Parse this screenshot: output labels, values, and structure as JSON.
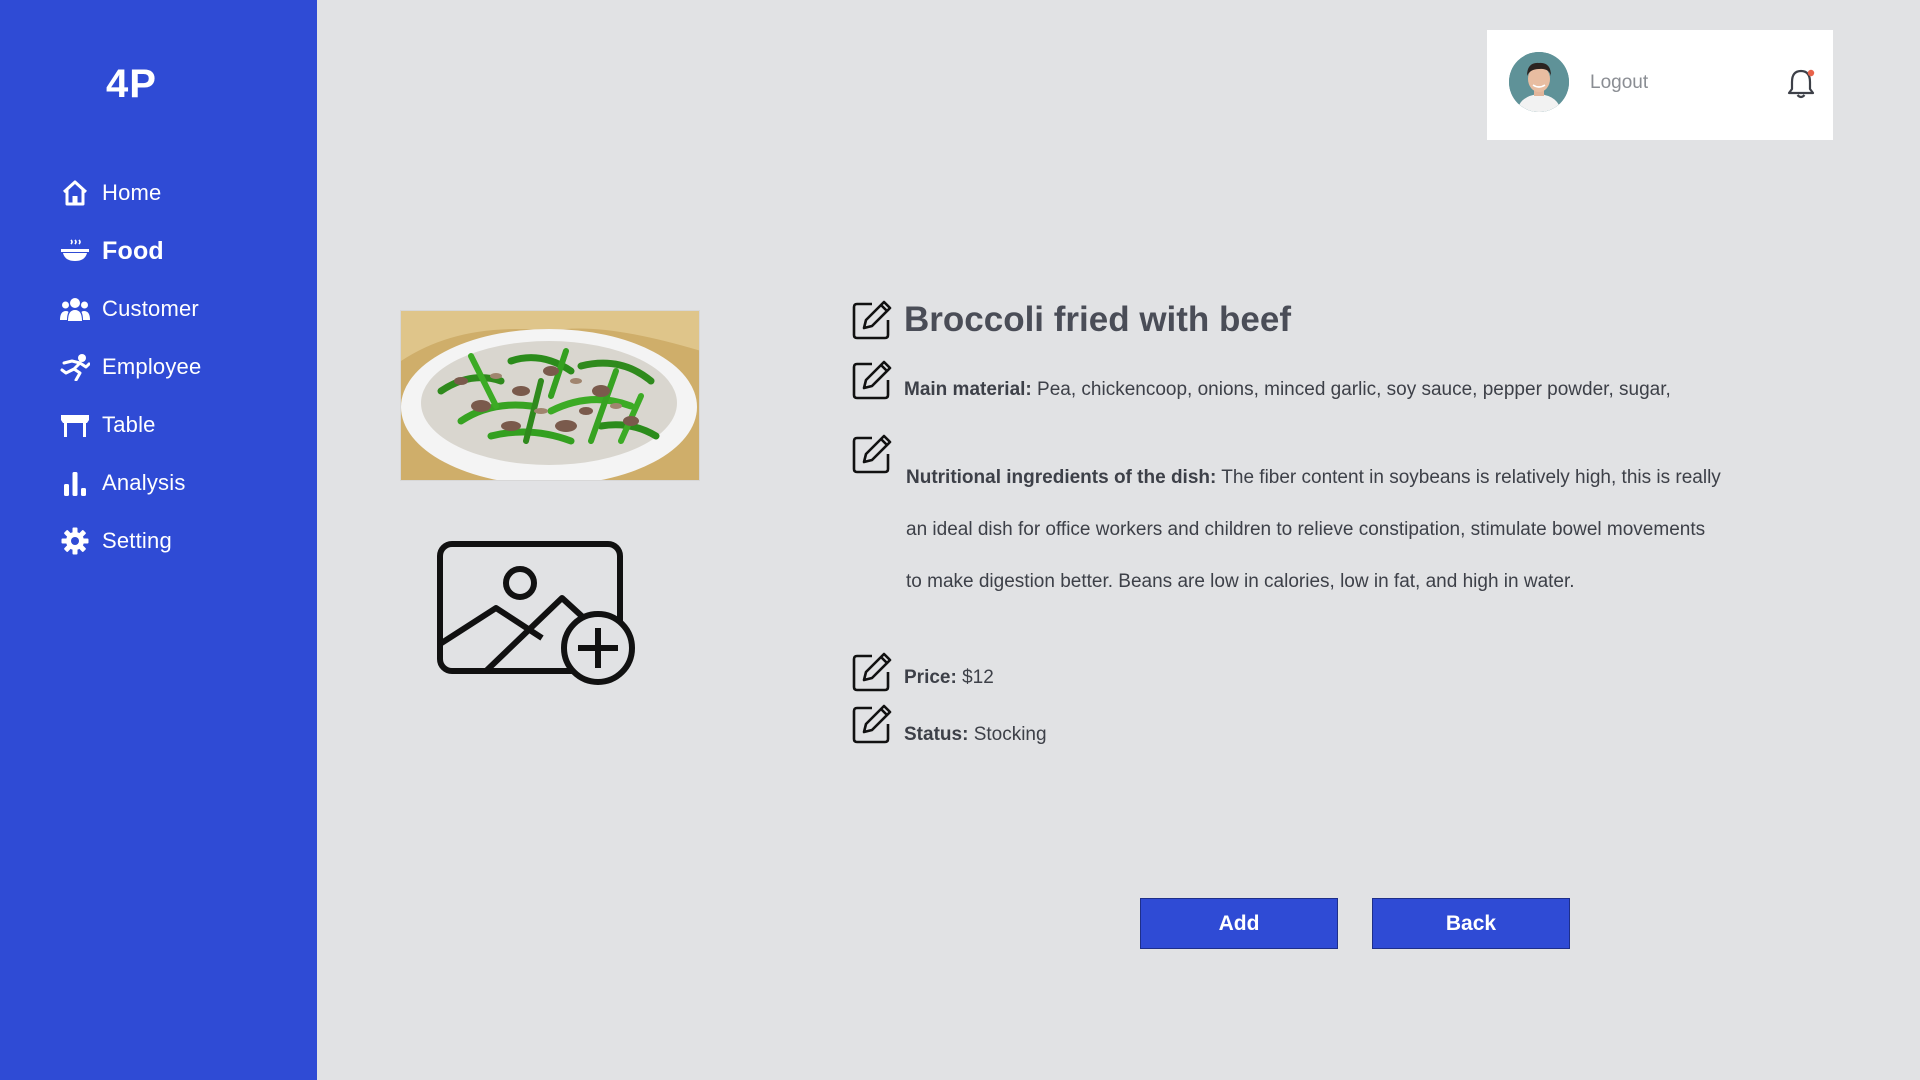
{
  "app": {
    "logo": "4P"
  },
  "sidebar": {
    "items": [
      {
        "label": "Home",
        "icon": "home-icon"
      },
      {
        "label": "Food",
        "icon": "food-bowl-icon",
        "active": true
      },
      {
        "label": "Customer",
        "icon": "users-icon"
      },
      {
        "label": "Employee",
        "icon": "employee-icon"
      },
      {
        "label": "Table",
        "icon": "table-icon"
      },
      {
        "label": "Analysis",
        "icon": "bar-chart-icon"
      },
      {
        "label": "Setting",
        "icon": "gear-icon"
      }
    ]
  },
  "header": {
    "logout_label": "Logout",
    "avatar_icon": "user-avatar",
    "bell_icon": "bell-icon"
  },
  "dish": {
    "title": "Broccoli fried with beef",
    "main_material_label": "Main material:",
    "main_material_value": "Pea, chickencoop, onions, minced garlic, soy sauce, pepper powder, sugar,",
    "nutrition_label": "Nutritional ingredients of the dish:",
    "nutrition_value": "The fiber  content in  soybeans is  relatively high,  this is really an ideal dish for office  workers and  children to relieve  constipation, stimulate bowel movements to make digestion better. Beans are low in calories, low in fat, and high in water.",
    "price_label": "Price:",
    "price_value": "$12",
    "status_label": "Status:",
    "status_value": "Stocking"
  },
  "actions": {
    "add_label": "Add",
    "back_label": "Back"
  },
  "colors": {
    "sidebar": "#2f4bd5",
    "background": "#e1e2e4",
    "button": "#2f4bd5",
    "notification_dot": "#e8624a"
  }
}
